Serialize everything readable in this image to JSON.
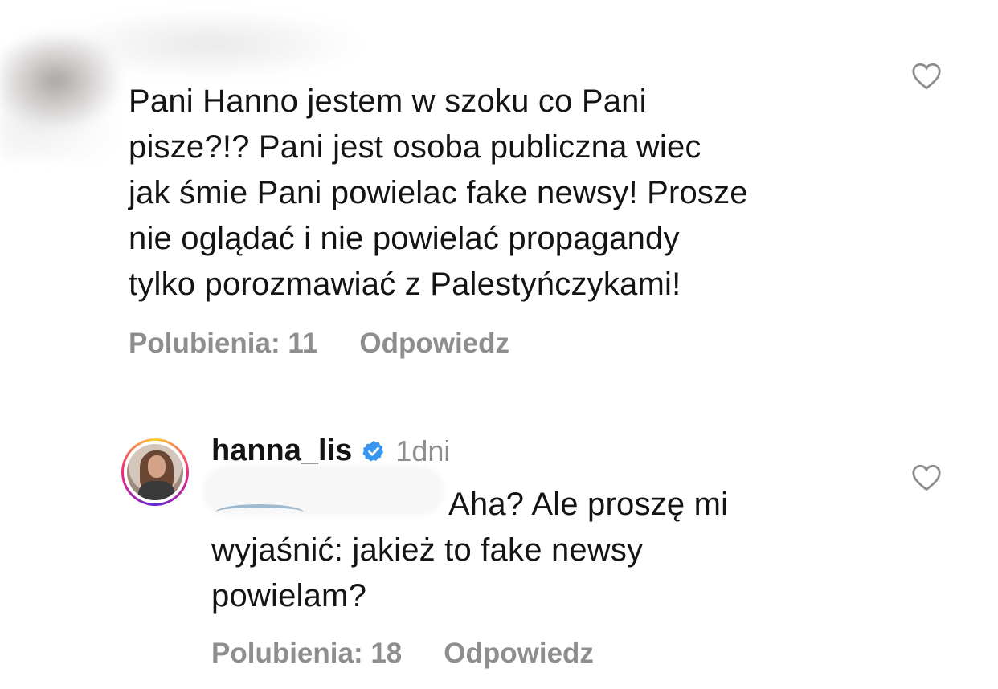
{
  "comment1": {
    "text": "Pani Hanno jestem w szoku co Pani\npisze?!? Pani jest osoba publiczna wiec\njak śmie Pani powielac fake newsy! Prosze\nnie oglądać i nie powielać propagandy\ntylko porozmawiać z Palestyńczykami!",
    "likes_label": "Polubienia: 11",
    "reply_label": "Odpowiedz"
  },
  "comment2": {
    "username": "hanna_lis",
    "timestamp": "1dni",
    "text_line1": "Aha? Ale proszę mi",
    "text_rest": "wyjaśnić: jakież to fake newsy\npowielam?",
    "likes_label": "Polubienia: 18",
    "reply_label": "Odpowiedz"
  },
  "icons": {
    "like": "heart-outline-icon",
    "verified": "verified-badge-icon"
  },
  "colors": {
    "verified": "#3797f0",
    "meta_text": "#8e8e8e",
    "text": "#141414"
  }
}
